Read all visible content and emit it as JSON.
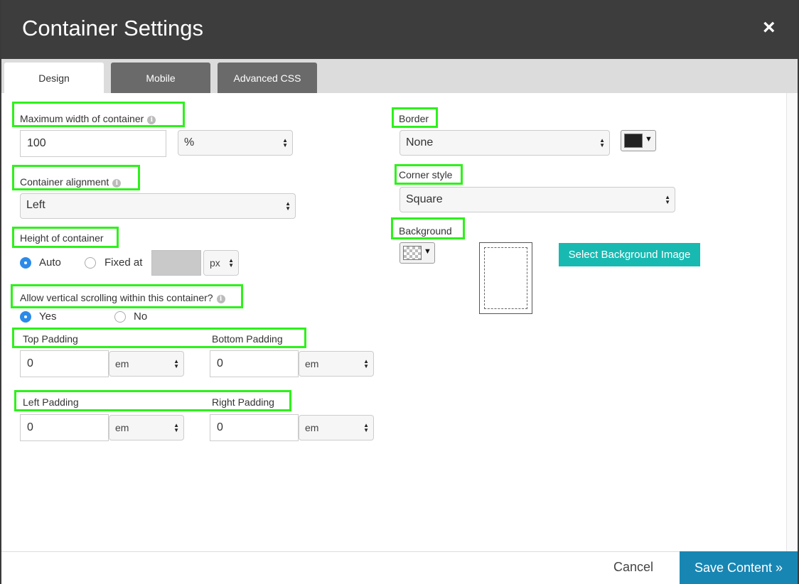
{
  "dialog": {
    "title": "Container Settings",
    "close_icon": "×",
    "tabs": [
      {
        "label": "Design",
        "active": true
      },
      {
        "label": "Mobile",
        "active": false
      },
      {
        "label": "Advanced CSS",
        "active": false
      }
    ]
  },
  "left": {
    "max_width": {
      "label": "Maximum width of container",
      "value": "100",
      "unit": "%"
    },
    "alignment": {
      "label": "Container alignment",
      "value": "Left"
    },
    "height": {
      "label": "Height of container",
      "auto_label": "Auto",
      "fixed_label": "Fixed at",
      "unit": "px",
      "selected": "Auto"
    },
    "scroll": {
      "label": "Allow vertical scrolling within this container?",
      "yes_label": "Yes",
      "no_label": "No",
      "selected": "Yes"
    },
    "padding_tb": {
      "top_label": "Top Padding",
      "bottom_label": "Bottom Padding",
      "top_value": "0",
      "top_unit": "em",
      "bottom_value": "0",
      "bottom_unit": "em"
    },
    "padding_lr": {
      "left_label": "Left Padding",
      "right_label": "Right Padding",
      "left_value": "0",
      "left_unit": "em",
      "right_value": "0",
      "right_unit": "em"
    }
  },
  "right": {
    "border": {
      "label": "Border",
      "value": "None",
      "color": "#222222"
    },
    "corner": {
      "label": "Corner style",
      "value": "Square"
    },
    "background": {
      "label": "Background",
      "button_label": "Select Background Image"
    }
  },
  "footer": {
    "cancel_label": "Cancel",
    "save_label": "Save Content »"
  },
  "icons": {
    "info": "i",
    "caret": "▼",
    "up_arrow": "▲",
    "down_arrow": "▼"
  },
  "colors": {
    "header_bg": "#3d3d3d",
    "highlight": "#2ef11b",
    "accent_teal": "#18b9b1",
    "save_blue": "#1886b3",
    "radio_blue": "#2c8ae8"
  }
}
